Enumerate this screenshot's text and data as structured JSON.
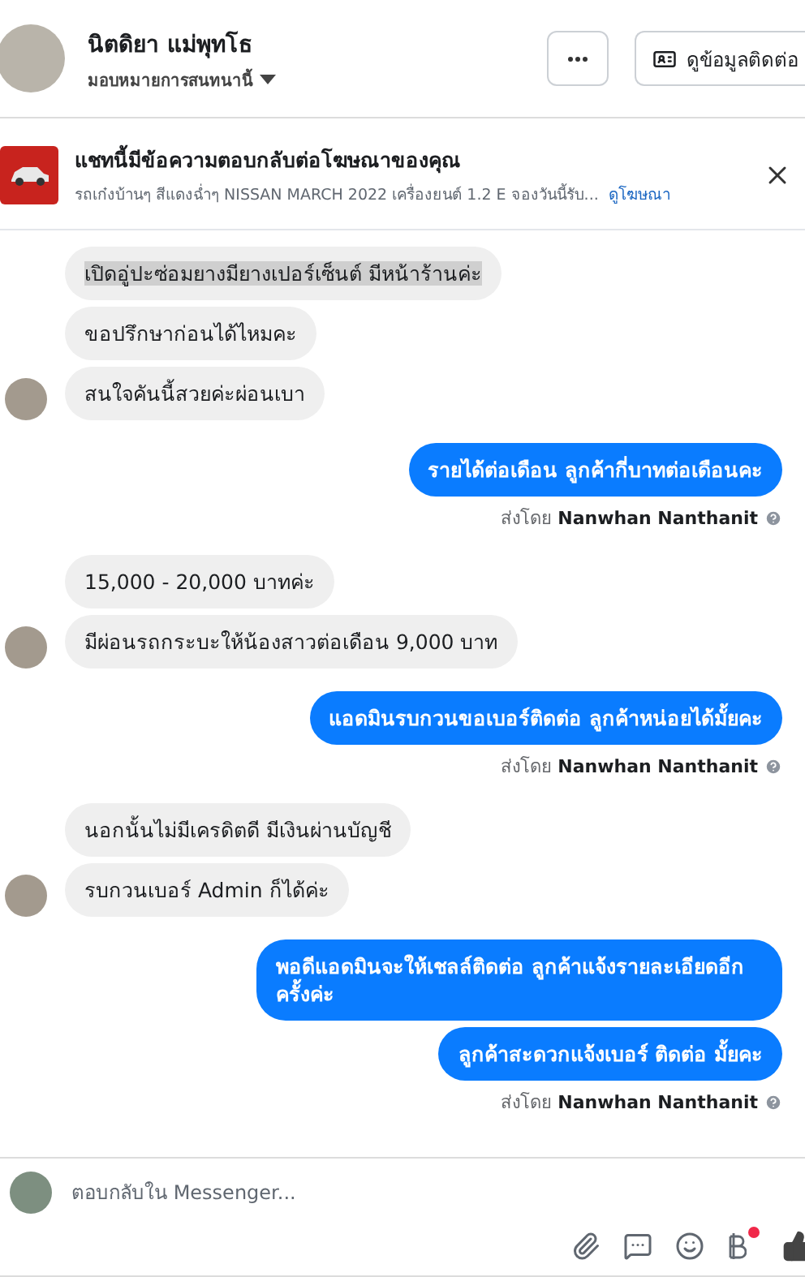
{
  "header": {
    "name": "นิตดิยา แม่พุทโธ",
    "subtitle": "มอบหมายการสนทนานี้",
    "contact_button": "ดูข้อมูลติดต่อ"
  },
  "ad_notice": {
    "title": "แชทนี้มีข้อความตอบกลับต่อโฆษณาของคุณ",
    "description": "รถเก๋งบ้านๆ สีแดงฉ่ำๆ NISSAN MARCH 2022 เครื่องยนต์ 1.2 E จองวันนี้รับ...",
    "link": "ดูโฆษณา"
  },
  "message_groups": [
    {
      "kind": "incoming",
      "messages": [
        {
          "text": "เปิดอู่ปะซ่อมยางมียางเปอร์เซ็นต์ มีหน้าร้านค่ะ",
          "selected": true
        },
        {
          "text": "ขอปรึกษาก่อนได้ไหมคะ",
          "selected": false
        },
        {
          "text": "สนใจคันนี้สวยค่ะผ่อนเบา",
          "selected": false
        }
      ]
    },
    {
      "kind": "outgoing",
      "messages": [
        {
          "text": "รายได้ต่อเดือน ลูกค้ากี่บาทต่อเดือนคะ",
          "selected": false
        }
      ],
      "sent_by_label": "ส่งโดย",
      "sent_by_name": "Nanwhan Nanthanit"
    },
    {
      "kind": "incoming",
      "messages": [
        {
          "text": "15,000 - 20,000 บาทค่ะ",
          "selected": false
        },
        {
          "text": "มีผ่อนรถกระบะให้น้องสาวต่อเดือน 9,000 บาท",
          "selected": false
        }
      ]
    },
    {
      "kind": "outgoing",
      "messages": [
        {
          "text": "แอดมินรบกวนขอเบอร์ติดต่อ ลูกค้าหน่อยได้มั้ยคะ",
          "selected": false
        }
      ],
      "sent_by_label": "ส่งโดย",
      "sent_by_name": "Nanwhan Nanthanit"
    },
    {
      "kind": "incoming",
      "messages": [
        {
          "text": "นอกนั้นไม่มีเครดิตดี มีเงินผ่านบัญชี",
          "selected": false
        },
        {
          "text": "รบกวนเบอร์ Admin ก็ได้ค่ะ",
          "selected": false
        }
      ]
    },
    {
      "kind": "outgoing",
      "messages": [
        {
          "text": "พอดีแอดมินจะให้เชลล์ติดต่อ ลูกค้าแจ้งรายละเอียดอีกครั้งค่ะ",
          "selected": false
        },
        {
          "text": "ลูกค้าสะดวกแจ้งเบอร์ ติดต่อ มั้ยคะ",
          "selected": false
        }
      ],
      "sent_by_label": "ส่งโดย",
      "sent_by_name": "Nanwhan Nanthanit"
    }
  ],
  "composer": {
    "placeholder": "ตอบกลับใน Messenger...",
    "payment_badge": true
  }
}
